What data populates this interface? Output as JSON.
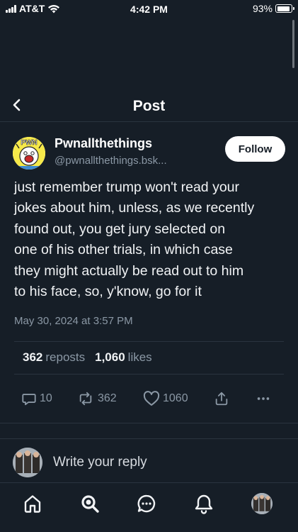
{
  "status_bar": {
    "carrier": "AT&T",
    "time": "4:42 PM",
    "battery": "93%",
    "battery_level": 0.93
  },
  "header": {
    "title": "Post"
  },
  "author": {
    "name": "Pwnallthethings",
    "handle": "@pwnallthethings.bsk...",
    "follow_label": "Follow",
    "avatar_text": "PWN"
  },
  "post": {
    "text": "just remember trump won't read your\njokes about him, unless, as we recently\nfound out, you get jury selected on\none of his other trials, in which case\nthey might actually be read out to him\nto his face, so, y'know, go for it",
    "date": "May 30, 2024 at 3:57 PM"
  },
  "stats": {
    "reposts_count": "362",
    "reposts_label": "reposts",
    "likes_count": "1,060",
    "likes_label": "likes"
  },
  "actions": {
    "replies": "10",
    "reposts": "362",
    "likes": "1060"
  },
  "reply": {
    "placeholder": "Write your reply"
  },
  "colors": {
    "background": "#161e27",
    "muted": "#8b98a5",
    "divider": "#2a343f"
  }
}
